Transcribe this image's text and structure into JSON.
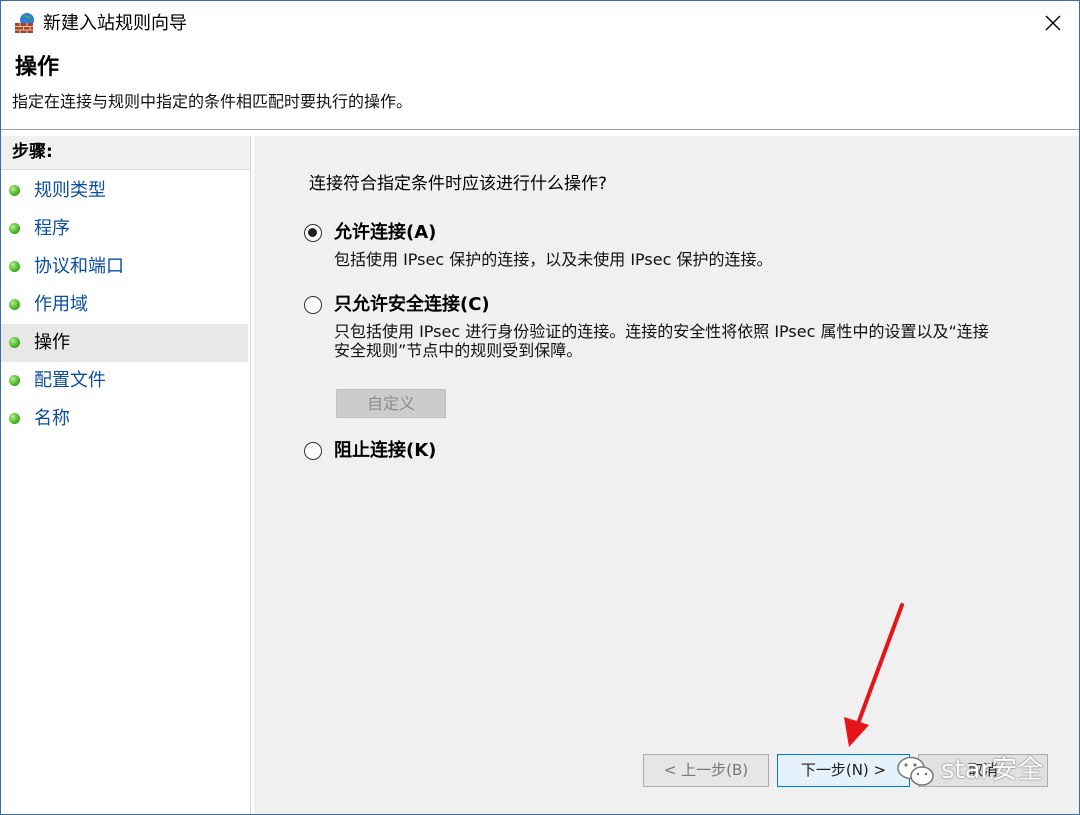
{
  "window": {
    "title": "新建入站规则向导",
    "close_icon": "close-icon",
    "app_icon": "firewall-wall-icon"
  },
  "header": {
    "title": "操作",
    "description": "指定在连接与规则中指定的条件相匹配时要执行的操作。"
  },
  "sidebar": {
    "heading": "步骤:",
    "items": [
      {
        "label": "规则类型",
        "active": false
      },
      {
        "label": "程序",
        "active": false
      },
      {
        "label": "协议和端口",
        "active": false
      },
      {
        "label": "作用域",
        "active": false
      },
      {
        "label": "操作",
        "active": true
      },
      {
        "label": "配置文件",
        "active": false
      },
      {
        "label": "名称",
        "active": false
      }
    ]
  },
  "main": {
    "question": "连接符合指定条件时应该进行什么操作?",
    "options": [
      {
        "label": "允许连接(A)",
        "description": "包括使用 IPsec 保护的连接，以及未使用 IPsec 保护的连接。",
        "checked": true
      },
      {
        "label": "只允许安全连接(C)",
        "description": "只包括使用 IPsec 进行身份验证的连接。连接的安全性将依照 IPsec 属性中的设置以及“连接安全规则”节点中的规则受到保障。",
        "checked": false
      },
      {
        "label": "阻止连接(K)",
        "description": "",
        "checked": false
      }
    ],
    "custom_button": "自定义"
  },
  "footer": {
    "back_label": "< 上一步(B)",
    "next_label": "下一步(N) >",
    "cancel_label": "取消"
  },
  "watermark": {
    "text": "star安全",
    "icon": "wechat-icon"
  },
  "colors": {
    "link": "#0b4ea2",
    "main_bg": "#f0f0f0",
    "arrow": "#e8141b",
    "focus_border": "#0078d7"
  }
}
